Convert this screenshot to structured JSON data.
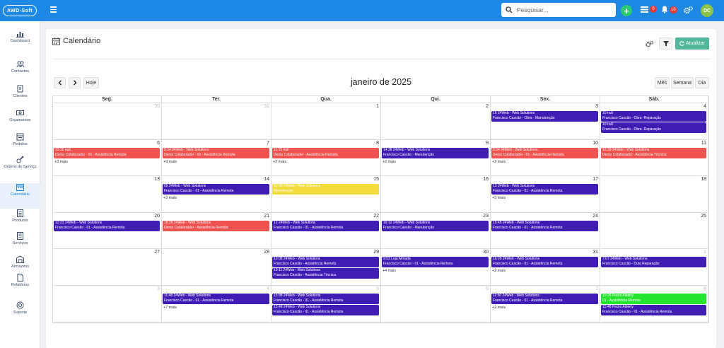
{
  "topbar": {
    "logo": "AWD-Soft",
    "search_placeholder": "Pesquisar...",
    "badge_messages": "0",
    "badge_notifications": "10",
    "avatar_initials": "DC"
  },
  "sidebar": {
    "items": [
      {
        "label": "Dashboard",
        "icon": "chart-icon"
      },
      {
        "label": "Contactos",
        "icon": "contacts-icon"
      },
      {
        "label": "Clientes",
        "icon": "clients-icon"
      },
      {
        "label": "Orçamentos",
        "icon": "budget-icon"
      },
      {
        "label": "Pedidos",
        "icon": "orders-icon"
      },
      {
        "label": "Ordens de Serviço",
        "icon": "service-orders-icon"
      },
      {
        "label": "Calendário",
        "icon": "calendar-icon"
      },
      {
        "label": "Produtos",
        "icon": "products-icon"
      },
      {
        "label": "Serviços",
        "icon": "services-icon"
      },
      {
        "label": "Armazéns",
        "icon": "warehouse-icon"
      },
      {
        "label": "Relatórios",
        "icon": "reports-icon"
      },
      {
        "label": "Suporte",
        "icon": "support-icon"
      }
    ],
    "active": "Calendário"
  },
  "page": {
    "title": "Calendário",
    "update_label": "Atualizar"
  },
  "calendar": {
    "title": "janeiro de 2025",
    "today_label": "Hoje",
    "views": [
      "Mês",
      "Semana",
      "Dia"
    ],
    "weekdays": [
      "Seg.",
      "Ter.",
      "Qua.",
      "Qui.",
      "Sex.",
      "Sáb."
    ],
    "weeks": [
      [
        {
          "day": "30",
          "other": true,
          "events": []
        },
        {
          "day": "31",
          "other": true,
          "events": []
        },
        {
          "day": "1",
          "events": []
        },
        {
          "day": "2",
          "events": []
        },
        {
          "day": "3",
          "events": [
            {
              "color": "purple",
              "l1": "16 24Web - Web Solutions",
              "l2": "Francisco Cascão - Obra - Manutenção"
            }
          ]
        },
        {
          "day": "4",
          "events": [
            {
              "color": "purple",
              "l1": "10 null",
              "l2": "Francisco Cascão - Obra -Reparação"
            },
            {
              "color": "purple",
              "l1": "10 null",
              "l2": "Francisco Cascão - Obra -Reparação"
            }
          ]
        }
      ],
      [
        {
          "day": "6",
          "more": "+3 mais",
          "events": [
            {
              "color": "red",
              "l1": "10:30 null",
              "l2": "Demo Colaborador - 01 - Assistência Remota"
            }
          ]
        },
        {
          "day": "7",
          "more": "+9 mais",
          "events": [
            {
              "color": "red",
              "l1": "8:34 24Web - Web Solutions",
              "l2": "Demo Colaborador - 01 - Assistência Remota"
            }
          ]
        },
        {
          "day": "8",
          "more": "+2 mais",
          "events": [
            {
              "color": "red",
              "l1": "11:15 null",
              "l2": "Demo Colaborador - Assistência Remota"
            }
          ]
        },
        {
          "day": "9",
          "more": "+2 mais",
          "events": [
            {
              "color": "purple",
              "l1": "14:38 24Web - Web Solutions",
              "l2": "Francisco Cascão - Manutenção"
            }
          ]
        },
        {
          "day": "10",
          "more": "+2 mais",
          "events": [
            {
              "color": "red",
              "l1": "8:34 24Web - Web Solutions",
              "l2": "Demo Colaborador - 01 - Assistência Remota"
            }
          ]
        },
        {
          "day": "11",
          "events": [
            {
              "color": "red",
              "l1": "12:39 24Web - Web Solutions",
              "l2": "Demo Colaborador - Assistência Técnica"
            }
          ]
        }
      ],
      [
        {
          "day": "13",
          "events": []
        },
        {
          "day": "14",
          "more": "+3 mais",
          "events": [
            {
              "color": "purple",
              "l1": "09 24Web - Web Solutions",
              "l2": "Francisco Cascão - 01 - Assistência Remota"
            }
          ]
        },
        {
          "day": "15",
          "events": [
            {
              "color": "yellow",
              "l1": "10:28 24Web - Web Solutions",
              "l2": "Manutenção"
            }
          ]
        },
        {
          "day": "16",
          "events": []
        },
        {
          "day": "17",
          "more": "+3 mais",
          "events": [
            {
              "color": "purple",
              "l1": "13 24Web - Web Solutions",
              "l2": "Francisco Cascão - 01 - Assistência Remota"
            }
          ]
        },
        {
          "day": "18",
          "events": []
        }
      ],
      [
        {
          "day": "20",
          "events": [
            {
              "color": "purple",
              "l1": "12:23 24Web - Web Solutions",
              "l2": "Francisco Cascão - 01 - Assistência Remota"
            }
          ]
        },
        {
          "day": "21",
          "events": [
            {
              "color": "red",
              "l1": "15:28 24Web - Web Solutions",
              "l2": "Demo Colaborador - Assistência Remota"
            }
          ]
        },
        {
          "day": "22",
          "events": [
            {
              "color": "purple",
              "l1": "12 24Web - Web Solutions",
              "l2": "Francisco Cascão - 01 - Assistência Remota"
            }
          ]
        },
        {
          "day": "23",
          "events": [
            {
              "color": "purple",
              "l1": "16:12 24Web - Web Solutions",
              "l2": "Francisco Cascão - Manutenção"
            }
          ]
        },
        {
          "day": "24",
          "events": [
            {
              "color": "purple",
              "l1": "15:45 24Web - Web Solutions",
              "l2": "Francisco Cascão - 01 - Assistência Remota"
            }
          ]
        },
        {
          "day": "25",
          "events": []
        }
      ],
      [
        {
          "day": "27",
          "events": []
        },
        {
          "day": "28",
          "events": []
        },
        {
          "day": "29",
          "events": [
            {
              "color": "purple",
              "l1": "10:08 24Web - Web Solutions",
              "l2": "Francisco Cascão - Assistência Remota"
            },
            {
              "color": "purple",
              "l1": "10:11 24Web - Web Solutions",
              "l2": "Francisco Cascão - Assistência Técnica"
            }
          ]
        },
        {
          "day": "30",
          "more": "+4 mais",
          "events": [
            {
              "color": "purple",
              "l1": "9:53 Loja Almada",
              "l2": "Francisco Cascão - 01 - Assistência Remota"
            }
          ]
        },
        {
          "day": "31",
          "more": "+2 mais",
          "events": [
            {
              "color": "purple",
              "l1": "16:26 24Web - Web Solutions",
              "l2": "Francisco Cascão - 01 - Assistência Remota"
            }
          ]
        },
        {
          "day": "1",
          "other": true,
          "events": [
            {
              "color": "purple",
              "l1": "7:07 24Web - Web Solutions",
              "l2": "Francisco Cascão - Dula Reparação"
            }
          ]
        }
      ],
      [
        {
          "day": "3",
          "other": true,
          "events": []
        },
        {
          "day": "4",
          "other": true,
          "more": "+7 mais",
          "events": [
            {
              "color": "purple",
              "l1": "11:48 24Web - Web Solutions",
              "l2": "Francisco Cascão - 01 - Assistência Remota"
            }
          ]
        },
        {
          "day": "5",
          "other": true,
          "events": [
            {
              "color": "purple",
              "l1": "15:38 24Web - Web Solutions",
              "l2": "Francisco Cascão - 01 - Assistência Remota"
            },
            {
              "color": "purple",
              "l1": "15:48 24Web - Web Solutions",
              "l2": "Francisco Cascão - 01 - Assistência Remota"
            }
          ]
        },
        {
          "day": "6",
          "other": true,
          "events": []
        },
        {
          "day": "7",
          "other": true,
          "more": "+2 mais",
          "events": [
            {
              "color": "purple",
              "l1": "11:50 24Web - Web Solutions",
              "l2": "Francisco Cascão - 01 - Assistência Remota"
            }
          ]
        },
        {
          "day": "8",
          "other": true,
          "events": [
            {
              "color": "green",
              "l1": "15:26 Pedro Alberty",
              "l2": "01 - Assistência Remota"
            },
            {
              "color": "purple",
              "l1": "15:48 Pedro Alberty",
              "l2": "Francisco Cascão - 01 - Assistência Remota"
            }
          ]
        }
      ]
    ]
  }
}
